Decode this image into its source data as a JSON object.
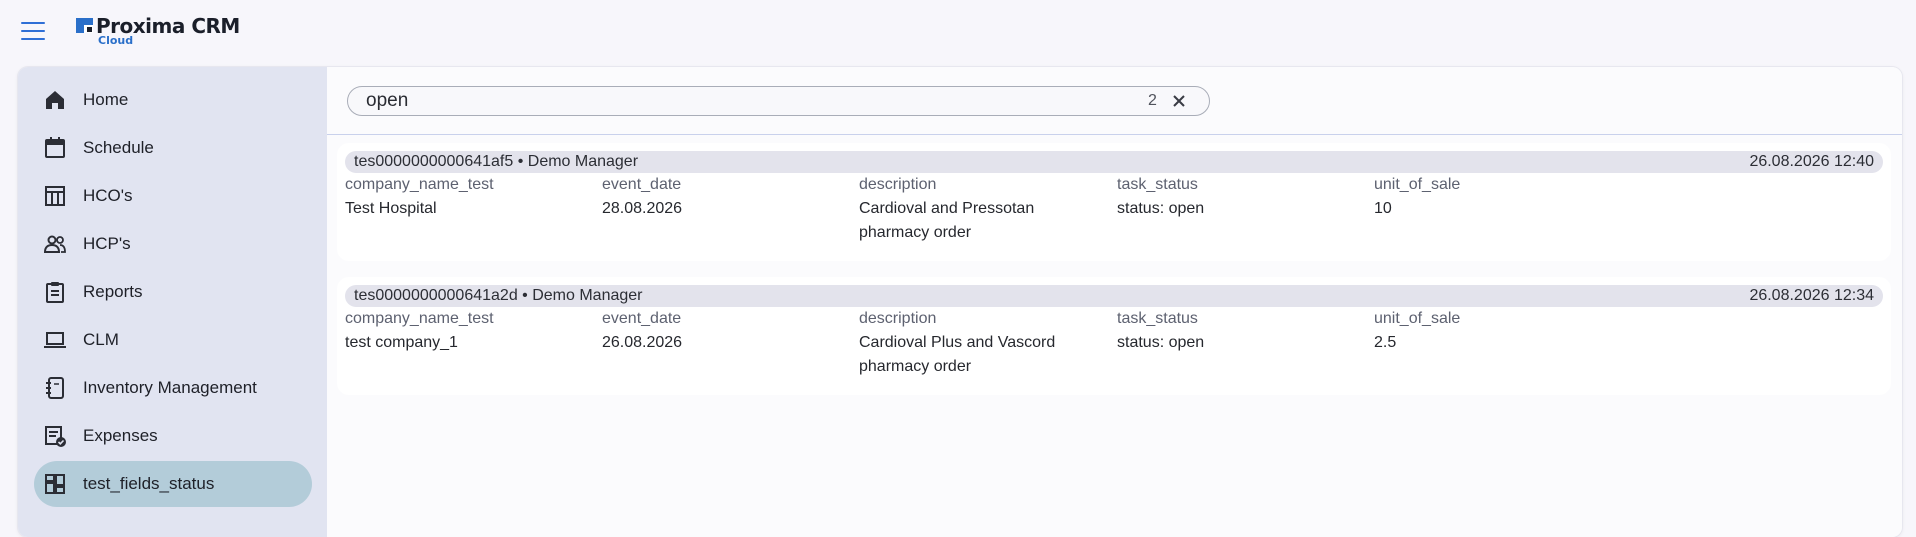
{
  "app": {
    "logo_name": "Proxima CRM",
    "logo_sub": "Cloud",
    "accent_color": "#2f6fd6"
  },
  "sidebar": {
    "items": [
      {
        "label": "Home",
        "icon": "home-icon",
        "active": false
      },
      {
        "label": "Schedule",
        "icon": "calendar-icon",
        "active": false
      },
      {
        "label": "HCO's",
        "icon": "table-icon",
        "active": false
      },
      {
        "label": "HCP's",
        "icon": "people-icon",
        "active": false
      },
      {
        "label": "Reports",
        "icon": "clipboard-icon",
        "active": false
      },
      {
        "label": "CLM",
        "icon": "laptop-icon",
        "active": false
      },
      {
        "label": "Inventory Management",
        "icon": "notebook-icon",
        "active": false
      },
      {
        "label": "Expenses",
        "icon": "receipt-check-icon",
        "active": false
      },
      {
        "label": "test_fields_status",
        "icon": "dashboard-icon",
        "active": true
      }
    ]
  },
  "search": {
    "value": "open",
    "count": "2"
  },
  "results": [
    {
      "title": "tes0000000000641af5 • Demo Manager",
      "date": "26.08.2026 12:40",
      "fields": [
        {
          "label": "company_name_test",
          "value": "Test Hospital"
        },
        {
          "label": "event_date",
          "value": "28.08.2026"
        },
        {
          "label": "description",
          "value": "Cardioval and Pressotan pharmacy order"
        },
        {
          "label": "task_status",
          "value": "status: open"
        },
        {
          "label": "unit_of_sale",
          "value": "10"
        }
      ]
    },
    {
      "title": "tes0000000000641a2d • Demo Manager",
      "date": "26.08.2026 12:34",
      "fields": [
        {
          "label": "company_name_test",
          "value": "test company_1"
        },
        {
          "label": "event_date",
          "value": "26.08.2026"
        },
        {
          "label": "description",
          "value": "Cardioval Plus and Vascord pharmacy order"
        },
        {
          "label": "task_status",
          "value": "status: open"
        },
        {
          "label": "unit_of_sale",
          "value": "2.5"
        }
      ]
    }
  ]
}
